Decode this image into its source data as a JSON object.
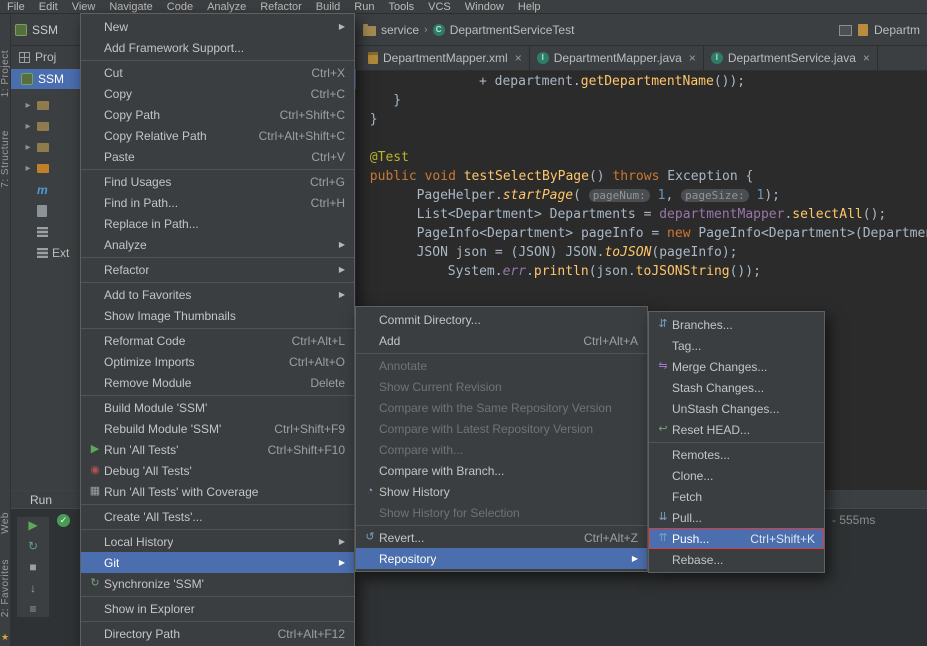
{
  "menubar": {
    "items": [
      "File",
      "Edit",
      "View",
      "Navigate",
      "Code",
      "Analyze",
      "Refactor",
      "Build",
      "Run",
      "Tools",
      "VCS",
      "Window",
      "Help"
    ]
  },
  "navbar": {
    "module": "SSM",
    "crumb_folder": "service",
    "crumb_class": "DepartmentServiceTest",
    "right_tab": "Departm"
  },
  "tool_stripes": {
    "top": [
      "1: Project",
      "7: Structure"
    ],
    "bottom": [
      "Web",
      "2: Favorites"
    ]
  },
  "project_panel": {
    "header": "Proj",
    "root": "SSM",
    "rows": [
      {
        "arrow": true,
        "icon": "folder",
        "label": ""
      },
      {
        "arrow": true,
        "icon": "folder",
        "label": ""
      },
      {
        "arrow": true,
        "icon": "folder",
        "label": ""
      },
      {
        "arrow": true,
        "icon": "folder-orange",
        "label": ""
      },
      {
        "arrow": false,
        "icon": "maven",
        "label": ""
      },
      {
        "arrow": false,
        "icon": "file",
        "label": ""
      },
      {
        "arrow": false,
        "icon": "lib",
        "label": ""
      },
      {
        "arrow": false,
        "icon": "lib",
        "label": "Ext"
      }
    ]
  },
  "tabs": [
    {
      "label": "DepartmentMapper.xml",
      "icon": "xml-file"
    },
    {
      "label": "DepartmentMapper.java",
      "icon": "java-interface"
    },
    {
      "label": "DepartmentService.java",
      "icon": "java-interface"
    }
  ],
  "editor": {
    "lines": [
      {
        "indent": 15,
        "segments": [
          {
            "t": "+ department.",
            "c": "plain"
          },
          {
            "t": "getDepartmentName",
            "c": "method"
          },
          {
            "t": "());",
            "c": "plain"
          }
        ]
      },
      {
        "indent": 4,
        "segments": [
          {
            "t": "}",
            "c": "plain"
          }
        ]
      },
      {
        "indent": 1,
        "segments": [
          {
            "t": "}",
            "c": "plain"
          }
        ]
      },
      {
        "indent": 0,
        "segments": []
      },
      {
        "indent": 1,
        "segments": [
          {
            "t": "@Test",
            "c": "ann"
          }
        ]
      },
      {
        "indent": 1,
        "segments": [
          {
            "t": "public",
            "c": "kw"
          },
          {
            "t": " ",
            "c": "plain"
          },
          {
            "t": "void",
            "c": "kw"
          },
          {
            "t": " ",
            "c": "plain"
          },
          {
            "t": "testSelectByPage",
            "c": "method"
          },
          {
            "t": "() ",
            "c": "plain"
          },
          {
            "t": "throws",
            "c": "kw"
          },
          {
            "t": " Exception {",
            "c": "plain"
          }
        ]
      },
      {
        "indent": 7,
        "segments": [
          {
            "t": "PageHelper.",
            "c": "plain"
          },
          {
            "t": "startPage",
            "c": "smethod"
          },
          {
            "t": "( ",
            "c": "plain"
          },
          {
            "t": "pageNum:",
            "c": "hint"
          },
          {
            "t": " ",
            "c": "plain"
          },
          {
            "t": "1",
            "c": "num"
          },
          {
            "t": ", ",
            "c": "plain"
          },
          {
            "t": "pageSize:",
            "c": "hint"
          },
          {
            "t": " ",
            "c": "plain"
          },
          {
            "t": "1",
            "c": "num"
          },
          {
            "t": ");",
            "c": "plain"
          }
        ]
      },
      {
        "indent": 7,
        "segments": [
          {
            "t": "List<Department> Departments = ",
            "c": "plain"
          },
          {
            "t": "departmentMapper",
            "c": "field"
          },
          {
            "t": ".",
            "c": "plain"
          },
          {
            "t": "selectAll",
            "c": "method"
          },
          {
            "t": "();",
            "c": "plain"
          }
        ]
      },
      {
        "indent": 7,
        "segments": [
          {
            "t": "PageInfo<Department> pageInfo = ",
            "c": "plain"
          },
          {
            "t": "new",
            "c": "kw"
          },
          {
            "t": " PageInfo<Department>(Departments);",
            "c": "plain"
          }
        ]
      },
      {
        "indent": 7,
        "segments": [
          {
            "t": "JSON json = (JSON) JSON.",
            "c": "plain"
          },
          {
            "t": "toJSON",
            "c": "smethod"
          },
          {
            "t": "(pageInfo);",
            "c": "plain"
          }
        ]
      },
      {
        "indent": 11,
        "segments": [
          {
            "t": "System.",
            "c": "plain"
          },
          {
            "t": "err",
            "c": "sfield"
          },
          {
            "t": ".",
            "c": "plain"
          },
          {
            "t": "println",
            "c": "method"
          },
          {
            "t": "(json.",
            "c": "plain"
          },
          {
            "t": "toJSONString",
            "c": "method"
          },
          {
            "t": "());",
            "c": "plain"
          }
        ]
      }
    ]
  },
  "run_panel": {
    "tab": "Run",
    "duration": "- 555ms",
    "toolbar_icons": [
      "play",
      "rerun",
      "stop",
      "down",
      "list"
    ]
  },
  "menus": {
    "main": {
      "items": [
        {
          "label": "New",
          "submenu": true
        },
        {
          "label": "Add Framework Support..."
        },
        {
          "separator": true
        },
        {
          "label": "Cut",
          "shortcut": "Ctrl+X"
        },
        {
          "label": "Copy",
          "shortcut": "Ctrl+C"
        },
        {
          "label": "Copy Path",
          "shortcut": "Ctrl+Shift+C"
        },
        {
          "label": "Copy Relative Path",
          "shortcut": "Ctrl+Alt+Shift+C"
        },
        {
          "label": "Paste",
          "shortcut": "Ctrl+V"
        },
        {
          "separator": true
        },
        {
          "label": "Find Usages",
          "shortcut": "Ctrl+G"
        },
        {
          "label": "Find in Path...",
          "shortcut": "Ctrl+H"
        },
        {
          "label": "Replace in Path..."
        },
        {
          "label": "Analyze",
          "submenu": true
        },
        {
          "separator": true
        },
        {
          "label": "Refactor",
          "submenu": true
        },
        {
          "separator": true
        },
        {
          "label": "Add to Favorites",
          "submenu": true
        },
        {
          "label": "Show Image Thumbnails"
        },
        {
          "separator": true
        },
        {
          "label": "Reformat Code",
          "shortcut": "Ctrl+Alt+L"
        },
        {
          "label": "Optimize Imports",
          "shortcut": "Ctrl+Alt+O"
        },
        {
          "label": "Remove Module",
          "shortcut": "Delete"
        },
        {
          "separator": true
        },
        {
          "label": "Build Module 'SSM'"
        },
        {
          "label": "Rebuild Module 'SSM'",
          "shortcut": "Ctrl+Shift+F9"
        },
        {
          "label": "Run 'All Tests'",
          "shortcut": "Ctrl+Shift+F10",
          "icon": "play"
        },
        {
          "label": "Debug 'All Tests'",
          "icon": "bug"
        },
        {
          "label": "Run 'All Tests' with Coverage",
          "icon": "coverage"
        },
        {
          "separator": true
        },
        {
          "label": "Create 'All Tests'..."
        },
        {
          "separator": true
        },
        {
          "label": "Local History",
          "submenu": true
        },
        {
          "label": "Git",
          "submenu": true,
          "selected": true
        },
        {
          "label": "Synchronize 'SSM'",
          "icon": "sync"
        },
        {
          "separator": true
        },
        {
          "label": "Show in Explorer"
        },
        {
          "separator": true
        },
        {
          "label": "Directory Path",
          "shortcut": "Ctrl+Alt+F12"
        }
      ]
    },
    "git": {
      "items": [
        {
          "label": "Commit Directory..."
        },
        {
          "label": "Add",
          "shortcut": "Ctrl+Alt+A"
        },
        {
          "separator": true
        },
        {
          "label": "Annotate",
          "disabled": true
        },
        {
          "label": "Show Current Revision",
          "disabled": true
        },
        {
          "label": "Compare with the Same Repository Version",
          "disabled": true
        },
        {
          "label": "Compare with Latest Repository Version",
          "disabled": true
        },
        {
          "label": "Compare with...",
          "disabled": true
        },
        {
          "label": "Compare with Branch..."
        },
        {
          "label": "Show History",
          "icon": "history"
        },
        {
          "label": "Show History for Selection",
          "disabled": true
        },
        {
          "separator": true
        },
        {
          "label": "Revert...",
          "shortcut": "Ctrl+Alt+Z",
          "icon": "revert"
        },
        {
          "label": "Repository",
          "submenu": true,
          "selected": true
        }
      ]
    },
    "repository": {
      "items": [
        {
          "label": "Branches...",
          "icon": "branch"
        },
        {
          "label": "Tag..."
        },
        {
          "label": "Merge Changes...",
          "icon": "merge"
        },
        {
          "label": "Stash Changes..."
        },
        {
          "label": "UnStash Changes..."
        },
        {
          "label": "Reset HEAD...",
          "icon": "reset"
        },
        {
          "separator": true
        },
        {
          "label": "Remotes..."
        },
        {
          "label": "Clone..."
        },
        {
          "label": "Fetch"
        },
        {
          "label": "Pull...",
          "icon": "pull"
        },
        {
          "label": "Push...",
          "shortcut": "Ctrl+Shift+K",
          "icon": "push",
          "selected": true,
          "red_box": true
        },
        {
          "label": "Rebase..."
        }
      ]
    }
  },
  "colors": {
    "selection_blue": "#4b6eaf",
    "red_highlight_box": "#e13c3c",
    "editor_bg": "#2b2b2b",
    "panel_bg": "#3c3f41",
    "keyword": "#cc7832",
    "annotation": "#bbb529",
    "method": "#ffc66b",
    "field": "#9876aa",
    "number": "#6897bb"
  }
}
